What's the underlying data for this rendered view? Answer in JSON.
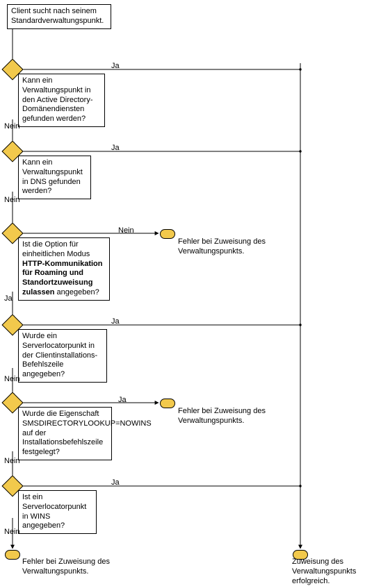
{
  "start": "Client sucht nach seinem Standardverwaltungspunkt.",
  "q1": "Kann ein Verwaltungspunkt in den Active Directory-Domänendiensten gefunden werden?",
  "q2": "Kann ein Verwaltungspunkt in DNS gefunden werden?",
  "q3_a": "Ist die Option für einheitlichen Modus ",
  "q3_b": "HTTP-Kommunikation für Roaming und Standortzuweisung zulassen",
  "q3_c": " angegeben?",
  "q4": "Wurde ein Serverlocatorpunkt in der Clientinstallations-Befehlszeile angegeben?",
  "q5": "Wurde die Eigenschaft SMSDIRECTORYLOOKUP=NOWINS auf der Installationsbefehlszeile festgelegt?",
  "q6": "Ist ein Serverlocatorpunkt in WINS angegeben?",
  "fail": "Fehler bei Zuweisung des Verwaltungspunkts.",
  "success": "Zuweisung des Verwaltungspunkts erfolgreich.",
  "yes": "Ja",
  "no": "Nein",
  "chart_data": {
    "type": "flowchart",
    "nodes": [
      {
        "id": "start",
        "type": "process",
        "text": "Client sucht nach seinem Standardverwaltungspunkt."
      },
      {
        "id": "q1",
        "type": "decision",
        "text": "Kann ein Verwaltungspunkt in den Active Directory-Domänendiensten gefunden werden?"
      },
      {
        "id": "q2",
        "type": "decision",
        "text": "Kann ein Verwaltungspunkt in DNS gefunden werden?"
      },
      {
        "id": "q3",
        "type": "decision",
        "text": "Ist die Option für einheitlichen Modus HTTP-Kommunikation für Roaming und Standortzuweisung zulassen angegeben?"
      },
      {
        "id": "fail3",
        "type": "terminator",
        "text": "Fehler bei Zuweisung des Verwaltungspunkts."
      },
      {
        "id": "q4",
        "type": "decision",
        "text": "Wurde ein Serverlocatorpunkt in der Clientinstallations-Befehlszeile angegeben?"
      },
      {
        "id": "q5",
        "type": "decision",
        "text": "Wurde die Eigenschaft SMSDIRECTORYLOOKUP=NOWINS auf der Installationsbefehlszeile festgelegt?"
      },
      {
        "id": "fail5",
        "type": "terminator",
        "text": "Fehler bei Zuweisung des Verwaltungspunkts."
      },
      {
        "id": "q6",
        "type": "decision",
        "text": "Ist ein Serverlocatorpunkt in WINS angegeben?"
      },
      {
        "id": "fail_end",
        "type": "terminator",
        "text": "Fehler bei Zuweisung des Verwaltungspunkts."
      },
      {
        "id": "success",
        "type": "terminator",
        "text": "Zuweisung des Verwaltungspunkts erfolgreich."
      }
    ],
    "edges": [
      {
        "from": "start",
        "to": "q1"
      },
      {
        "from": "q1",
        "to": "success",
        "label": "Ja"
      },
      {
        "from": "q1",
        "to": "q2",
        "label": "Nein"
      },
      {
        "from": "q2",
        "to": "success",
        "label": "Ja"
      },
      {
        "from": "q2",
        "to": "q3",
        "label": "Nein"
      },
      {
        "from": "q3",
        "to": "fail3",
        "label": "Nein"
      },
      {
        "from": "q3",
        "to": "q4",
        "label": "Ja"
      },
      {
        "from": "q4",
        "to": "success",
        "label": "Ja"
      },
      {
        "from": "q4",
        "to": "q5",
        "label": "Nein"
      },
      {
        "from": "q5",
        "to": "fail5",
        "label": "Ja"
      },
      {
        "from": "q5",
        "to": "q6",
        "label": "Nein"
      },
      {
        "from": "q6",
        "to": "success",
        "label": "Ja"
      },
      {
        "from": "q6",
        "to": "fail_end",
        "label": "Nein"
      }
    ]
  }
}
